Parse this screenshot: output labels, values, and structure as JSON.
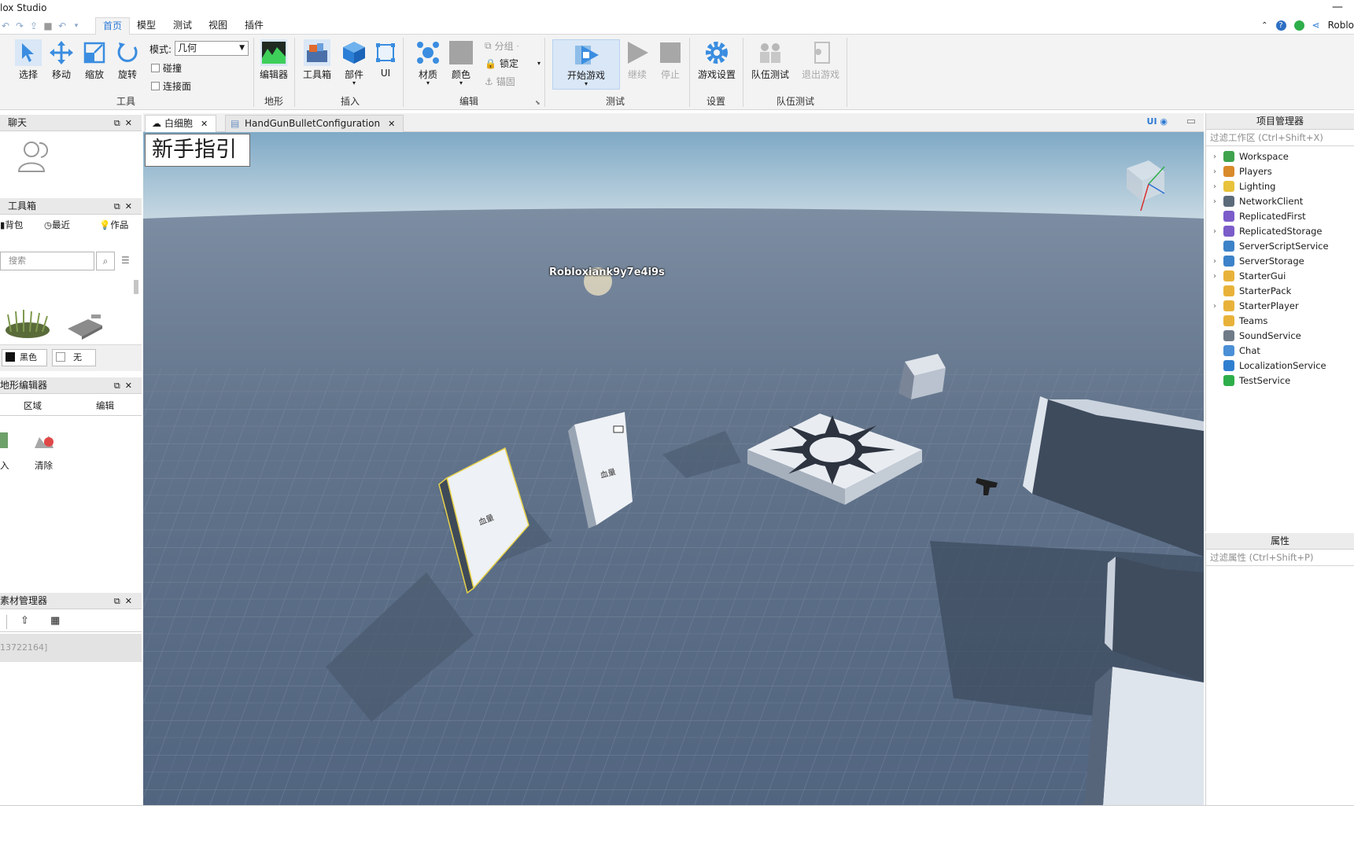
{
  "window": {
    "title": "lox Studio",
    "minimize": "—"
  },
  "menu_tabs": [
    "首页",
    "模型",
    "测试",
    "视图",
    "插件"
  ],
  "topright": {
    "app_label": "Roblo"
  },
  "ribbon": {
    "tools": {
      "select": "选择",
      "move": "移动",
      "scale": "缩放",
      "rotate": "旋转",
      "group": "工具"
    },
    "mode_label": "模式:",
    "mode_value": "几何",
    "collide": "碰撞",
    "join_surfaces": "连接面",
    "terrain": {
      "editor": "编辑器",
      "group": "地形"
    },
    "insert": {
      "toolbox": "工具箱",
      "part": "部件",
      "ui": "UI",
      "group": "插入"
    },
    "edit": {
      "material": "材质",
      "color": "颜色",
      "group_btn": "分组",
      "lock": "锁定",
      "anchor": "锚固",
      "group": "编辑"
    },
    "test": {
      "play": "开始游戏",
      "resume": "继续",
      "stop": "停止",
      "group": "测试"
    },
    "settings": {
      "game_settings": "游戏设置",
      "group": "设置"
    },
    "team_test": {
      "team_test": "队伍测试",
      "exit_game": "退出游戏",
      "group": "队伍测试"
    }
  },
  "left": {
    "chat": {
      "title": "聊天"
    },
    "toolbox": {
      "title": "工具箱",
      "tabs": [
        "背包",
        "最近",
        "作品"
      ],
      "search_placeholder": "搜索",
      "bg_black": "黑色",
      "bg_none": "无"
    },
    "terrain_editor": {
      "title": "地形编辑器",
      "tabs": [
        "区域",
        "编辑"
      ],
      "import": "入",
      "clear": "清除"
    },
    "asset_manager": {
      "title": "素材管理器",
      "id_text": "13722164]"
    }
  },
  "viewtabs": [
    {
      "label": "白细胞",
      "active": true
    },
    {
      "label": "HandGunBulletConfiguration",
      "active": false
    }
  ],
  "viewport": {
    "guide_button": "新手指引",
    "ui_toggle": "UI",
    "player_name": "Robloxiank9y7e4i9s",
    "part_label_1": "血量",
    "part_label_2": "血量"
  },
  "explorer": {
    "title": "项目管理器",
    "filter_placeholder": "过滤工作区 (Ctrl+Shift+X)",
    "items": [
      {
        "name": "Workspace",
        "expandable": true,
        "color": "#3fa34d"
      },
      {
        "name": "Players",
        "expandable": true,
        "color": "#d98a2b"
      },
      {
        "name": "Lighting",
        "expandable": true,
        "color": "#e8c23a"
      },
      {
        "name": "NetworkClient",
        "expandable": true,
        "color": "#5c6b7a"
      },
      {
        "name": "ReplicatedFirst",
        "expandable": false,
        "color": "#7b5cc9"
      },
      {
        "name": "ReplicatedStorage",
        "expandable": true,
        "color": "#7b5cc9"
      },
      {
        "name": "ServerScriptService",
        "expandable": false,
        "color": "#3c82c8"
      },
      {
        "name": "ServerStorage",
        "expandable": true,
        "color": "#3c82c8"
      },
      {
        "name": "StarterGui",
        "expandable": true,
        "color": "#e8b23a"
      },
      {
        "name": "StarterPack",
        "expandable": false,
        "color": "#e8b23a"
      },
      {
        "name": "StarterPlayer",
        "expandable": true,
        "color": "#e8b23a"
      },
      {
        "name": "Teams",
        "expandable": false,
        "color": "#e8b23a"
      },
      {
        "name": "SoundService",
        "expandable": false,
        "color": "#6f7b87"
      },
      {
        "name": "Chat",
        "expandable": false,
        "color": "#4b8fd6"
      },
      {
        "name": "LocalizationService",
        "expandable": false,
        "color": "#2f7fd0"
      },
      {
        "name": "TestService",
        "expandable": false,
        "color": "#2eae4a"
      }
    ]
  },
  "properties": {
    "title": "属性",
    "filter_placeholder": "过滤属性 (Ctrl+Shift+P)"
  },
  "colors": {
    "accent": "#2d7ad6",
    "sky_top": "#8fb6cf",
    "ground": "#5d6f86"
  }
}
